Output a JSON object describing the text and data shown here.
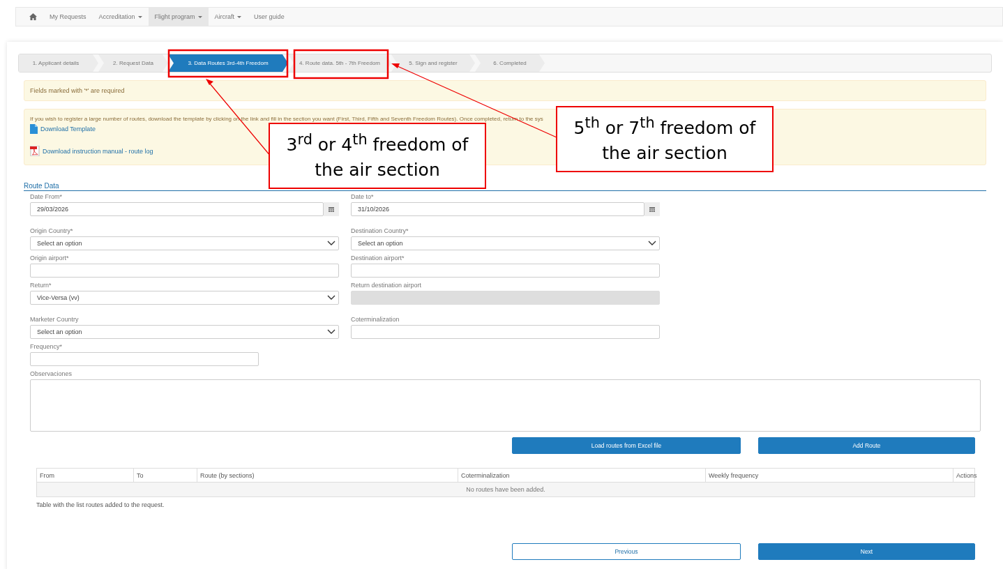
{
  "navbar": {
    "items": [
      {
        "label": "My Requests",
        "dropdown": false,
        "selected": false
      },
      {
        "label": "Accreditation",
        "dropdown": true,
        "selected": false
      },
      {
        "label": "Flight program",
        "dropdown": true,
        "selected": true
      },
      {
        "label": "Aircraft",
        "dropdown": true,
        "selected": false
      },
      {
        "label": "User guide",
        "dropdown": false,
        "selected": false
      }
    ]
  },
  "steps": [
    {
      "label": "1. Applicant details",
      "selected": false
    },
    {
      "label": "2. Request Data",
      "selected": false
    },
    {
      "label": "3. Data Routes 3rd-4th Freedom",
      "selected": true
    },
    {
      "label": "4. Route data. 5th - 7th Freedom",
      "selected": false
    },
    {
      "label": "5. Sign and register",
      "selected": false
    },
    {
      "label": "6. Completed",
      "selected": false
    }
  ],
  "required_notice": "Fields marked with '*' are required",
  "info": {
    "text": "If you wish to register a large number of routes, download the template by clicking on the link and fill in the section you want (First, Third, Fifth and Seventh Freedom Routes). Once completed, return to the sys",
    "links": [
      {
        "label": "Download Template",
        "kind": "doc"
      },
      {
        "label": "Download instruction manual - route log",
        "kind": "pdf"
      }
    ]
  },
  "section_title": "Route Data",
  "fields": [
    {
      "label": "Date From*",
      "kind": "date",
      "value": "29/03/2026",
      "disabled": false
    },
    {
      "label": "Date to*",
      "kind": "date",
      "value": "31/10/2026",
      "disabled": false
    },
    {
      "label": "Origin Country*",
      "kind": "select",
      "value": "Select an option",
      "disabled": false
    },
    {
      "label": "Destination Country*",
      "kind": "select",
      "value": "Select an option",
      "disabled": false
    },
    {
      "label": "Origin airport*",
      "kind": "text",
      "disabled": false
    },
    {
      "label": "Destination airport*",
      "kind": "text",
      "disabled": false
    },
    {
      "label": "Return*",
      "kind": "select",
      "value": "Vice-Versa (vv)",
      "disabled": false
    },
    {
      "label": "Return destination airport",
      "kind": "text",
      "disabled": true
    },
    {
      "label": "Marketer Country",
      "kind": "select",
      "value": "Select an option",
      "disabled": false
    },
    {
      "label": "Coterminalization",
      "kind": "text",
      "disabled": false
    }
  ],
  "frequency": {
    "label": "Frequency*"
  },
  "observations": {
    "label": "Observaciones"
  },
  "actions": [
    "Load routes from Excel file",
    "Add Route"
  ],
  "table": {
    "columns": [
      "From",
      "To",
      "Route (by sections)",
      "Coterminalization",
      "Weekly frequency",
      "Actions"
    ],
    "empty": "No routes have been added.",
    "caption": "Table with the list routes added to the request."
  },
  "nav_buttons": [
    {
      "label": "Previous",
      "kind": "secondary"
    },
    {
      "label": "Next",
      "kind": "primary"
    }
  ],
  "callouts": [
    "3$^{rd}$ or 4$^{th}$ freedom of the air section",
    "5$^{th}$ or 7$^{th}$ freedom of the air section"
  ]
}
